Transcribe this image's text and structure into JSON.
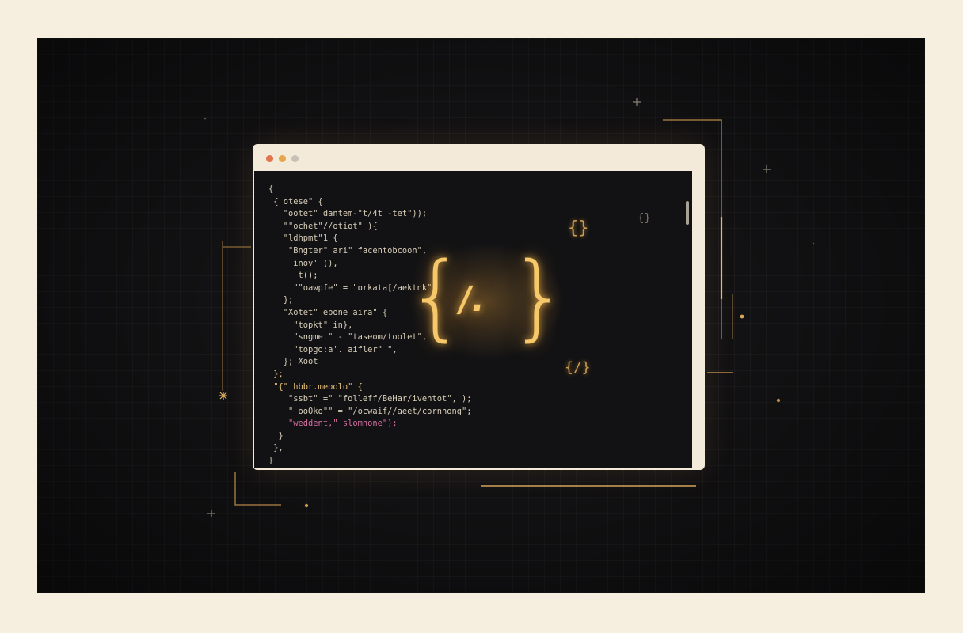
{
  "colors": {
    "background": "#f6efe0",
    "stage": "#141315",
    "window_frame": "#f3eada",
    "accent_gold": "#f6c86a",
    "traffic_red": "#e2754d",
    "traffic_yellow": "#e6a64a",
    "traffic_gray": "#c7c1b6"
  },
  "code_lines": [
    "{",
    " { otese\" {",
    "   \"ootet\" dantem-\"t/4t -tet\"));",
    "   \"\"ochet\"//otiot\" ){",
    "   \"ldhpmt\"1 {",
    "    \"Bngter\" ari\" facentobcoon\",",
    "     inov' (),",
    "      t();",
    "     \"\"oawpfe\" = \"orkata[/aektnk\",",
    "   };",
    "   \"Xotet\" epone aira\" {",
    "     \"topkt\" in},",
    "     \"sngmet\" - \"taseom/toolet\",",
    "     \"topgo:a'. aifler\" \",",
    "   }; Xoot",
    " };",
    " \"{\" hbbr.meoolo\" {",
    "    \"ssbt\" =\" \"folleff/BeHar/iventot\", );",
    "    \" ooOko\"\" = \"/ocwaif//aeet/cornnong\";",
    "    \"weddent,\" slomnone\");",
    "  }",
    " },",
    "}"
  ],
  "center_icon": {
    "left_brace": "{",
    "slash": "/.",
    "right_brace": "}"
  },
  "small_icons": {
    "brace_top": "{}",
    "brace_top_right": "{}",
    "brace_bottom": "{/}"
  }
}
